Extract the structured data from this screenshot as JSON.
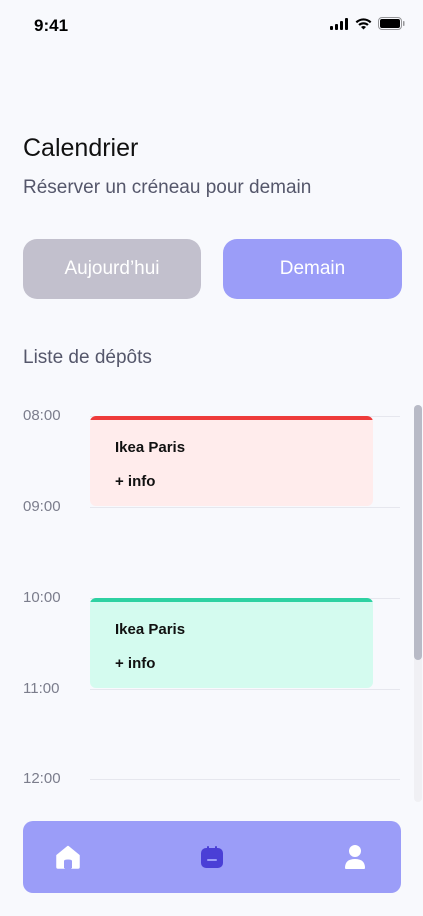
{
  "status_bar": {
    "time": "9:41"
  },
  "header": {
    "title": "Calendrier",
    "subtitle": "Réserver un créneau pour demain"
  },
  "day_toggle": {
    "today_label": "Aujourd’hui",
    "tomorrow_label": "Demain",
    "selected": "tomorrow"
  },
  "deposits": {
    "section_title": "Liste de dépôts",
    "hours": [
      "08:00",
      "09:00",
      "10:00",
      "11:00",
      "12:00"
    ],
    "events": [
      {
        "name": "Ikea Paris",
        "info": "+ info",
        "start": "08:00",
        "end": "09:00",
        "color": "#ee3b3b",
        "bg": "#ffecec"
      },
      {
        "name": "Ikea Paris",
        "info": "+ info",
        "start": "10:00",
        "end": "11:00",
        "color": "#2ed1a2",
        "bg": "#d4fbef"
      }
    ]
  },
  "nav": {
    "items": [
      {
        "icon": "home-icon",
        "active": false
      },
      {
        "icon": "calendar-icon",
        "active": true
      },
      {
        "icon": "user-icon",
        "active": false
      }
    ]
  },
  "colors": {
    "accent": "#9b9df8",
    "inactive_button": "#c2c0cd",
    "background": "#f8f9fd",
    "active_icon": "#4a3fd6"
  }
}
